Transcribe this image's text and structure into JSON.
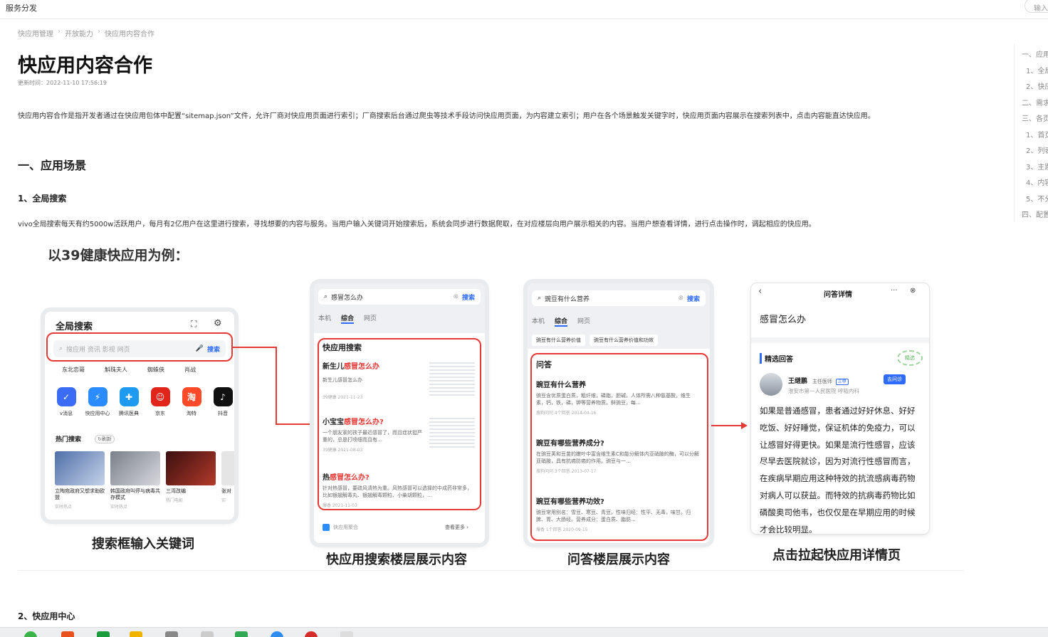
{
  "topbar": {
    "brand": "服务分发",
    "search_placeholder": "输入"
  },
  "breadcrumb": [
    "快应用管理",
    "开放能力",
    "快应用内容合作"
  ],
  "page": {
    "title": "快应用内容合作",
    "updated": "更新时间：2022-11-10 17:56:19",
    "intro": "快应用内容合作是指开发者通过在快应用包体中配置“sitemap.json”文件，允许厂商对快应用页面进行索引；厂商搜索后台通过爬虫等技术手段访问快应用页面，为内容建立索引；用户在各个场景触发关键字时，快应用页面内容展示在搜索列表中，点击内容能直达快应用。",
    "section1": "一、应用场景",
    "sub1": "1、全局搜索",
    "para1": "vivo全局搜索每天有约5000w活跃用户，每月有2亿用户在这里进行搜索，寻找想要的内容与服务。当用户输入关键词开始搜索后，系统会同步进行数据爬取，在对应楼层向用户展示相关的内容。当用户想查看详情，进行点击操作时，调起相应的快应用。",
    "sub2": "2、快应用中心"
  },
  "toc": [
    "一、应用",
    "1、全局",
    "2、快应",
    "二、需求",
    "三、各页",
    "1、首页",
    "2、列表",
    "3、主题",
    "4、内容",
    "5、不分",
    "四、配置"
  ],
  "figure": {
    "heading": "以39健康快应用为例：",
    "captions": [
      "搜索框输入关键词",
      "快应用搜索楼层展示内容",
      "问答楼层展示内容",
      "点击拉起快应用详情页"
    ],
    "phone1": {
      "title": "全局搜索",
      "search_placeholder": "搜应用 资讯 影视 网页",
      "search_btn": "搜索",
      "hot_words": [
        "东北恋哥",
        "斛珠夫人",
        "蜘蛛侠",
        "肖战"
      ],
      "apps": [
        "v消息",
        "快应用中心",
        "腾讯医典",
        "京东",
        "淘特",
        "抖音"
      ],
      "hot_title": "热门搜索",
      "refresh": "刷新",
      "hot_items": [
        {
          "title": "立陶宛政府又想求助欧盟",
          "meta": "实时热点"
        },
        {
          "title": "韩国政府叫停与病毒共存模式",
          "meta": "实时热点"
        },
        {
          "title": "三湾改编",
          "meta": "热门电影"
        },
        {
          "title": "张对",
          "meta": "实"
        }
      ]
    },
    "phone2": {
      "query": "感冒怎么办",
      "search_btn": "搜索",
      "tabs": [
        "本机",
        "综合",
        "网页"
      ],
      "floor_title": "快应用搜索",
      "results": [
        {
          "title_pre": "新生儿",
          "title_hl": "感冒怎么办",
          "text": "新生儿感冒怎么办",
          "meta": "39健康 2021-11-23"
        },
        {
          "title_pre": "小宝宝",
          "title_hl": "感冒怎么办?",
          "text": "一个朋友家的孩子最近感冒了，而且症状挺严重的，总是打喷嚏而且有…",
          "meta": "39健康 2021-08-03"
        },
        {
          "title_pre": "热",
          "title_hl": "感冒怎么办?",
          "text": "针对热感冒，要疏风清热为重。风热感冒可以选择的中成药非常多，比如银翘解毒丸、银翘解毒颗粒、小柴胡颗粒，…",
          "meta": "爆香 2021-11-03"
        }
      ],
      "footer": "快应用聚合",
      "more": "查看更多"
    },
    "phone3": {
      "query": "豌豆有什么营养",
      "search_btn": "搜索",
      "tabs": [
        "本机",
        "综合",
        "网页"
      ],
      "chips": [
        "豌豆有什么营养价值",
        "豌豆有什么营养价值和功效"
      ],
      "floor_title": "问答",
      "results": [
        {
          "title": "豌豆有什么营养",
          "text": "豌豆含优质蛋白质，粗纤维，磷脂，胆碱，人体所需八种氨基酸，维生素，钙，铁，磷，钾等营养物质。鲜豌豆，每…",
          "meta": "搜狗问问 4个回答 2014-04-16"
        },
        {
          "title": "豌豆有哪些营养成分?",
          "text": "在豌豆荚和豆苗的嫩叶中富含维生素C和能分解体内亚硝胺的酶，可以分解亚硝胺，具有抗癌防癌的作用。豌豆与一…",
          "meta": "搜狗问问 3个回答 2013-07-17"
        },
        {
          "title": "豌豆有哪些营养功效?",
          "text": "豌豆常用别名：雪豆、寒豆、青豆。性味归经：性平、无毒，味甘。归脾、胃、大肠经。营养成分：蛋白质、脂肪…",
          "meta": "爆香 1个回答 2020-09-15"
        }
      ]
    },
    "phone4": {
      "header": "问答详情",
      "question": "感冒怎么办",
      "answer_label": "精选回答",
      "badge": "精选",
      "doctor": "王继鹏",
      "doctor_title": "主任医师",
      "tag": "三甲",
      "hospital": "淮安市第一人民医院 呼吸内科",
      "ask_btn": "去问诊",
      "answer": "如果是普通感冒，患者通过好好休息、好好吃饭、好好睡觉，保证机体的免疫力，可以让感冒好得更快。如果是流行性感冒，应该尽早去医院就诊，因为对流行性感冒而言，在疾病早期应用这种特效的抗流感病毒药物对病人可以获益。而特效的抗病毒药物比如磷酸奥司他韦，也仅仅是在早期应用的时候才会比较明显。"
    }
  }
}
